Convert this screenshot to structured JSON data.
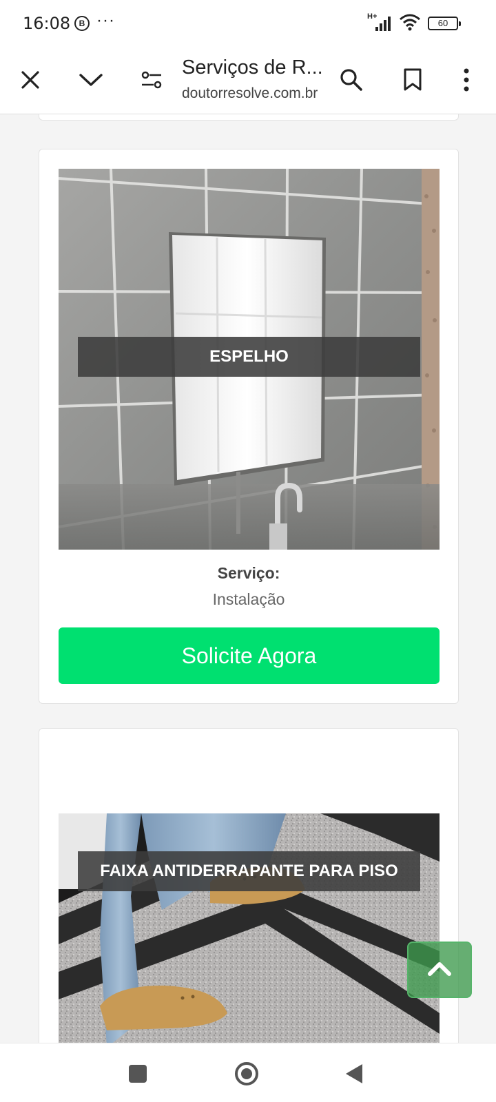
{
  "status_bar": {
    "time": "16:08",
    "b_badge": "B",
    "dots": "···",
    "network": "H+",
    "battery": "60"
  },
  "toolbar": {
    "page_title": "Serviços de R...",
    "url": "doutorresolve.com.br"
  },
  "cards": [
    {
      "image_label": "ESPELHO",
      "service_label": "Serviço:",
      "service_value": "Instalação",
      "button_label": "Solicite Agora"
    },
    {
      "image_label": "FAIXA ANTIDERRAPANTE PARA PISO"
    }
  ],
  "colors": {
    "cta_green": "#00e070",
    "scroll_top_green": "#3d9a4d"
  },
  "icons": [
    "close-icon",
    "chevron-down-icon",
    "page-settings-icon",
    "search-icon",
    "bookmark-icon",
    "more-vert-icon",
    "chevron-up-icon",
    "recents-icon",
    "home-icon",
    "back-icon"
  ]
}
